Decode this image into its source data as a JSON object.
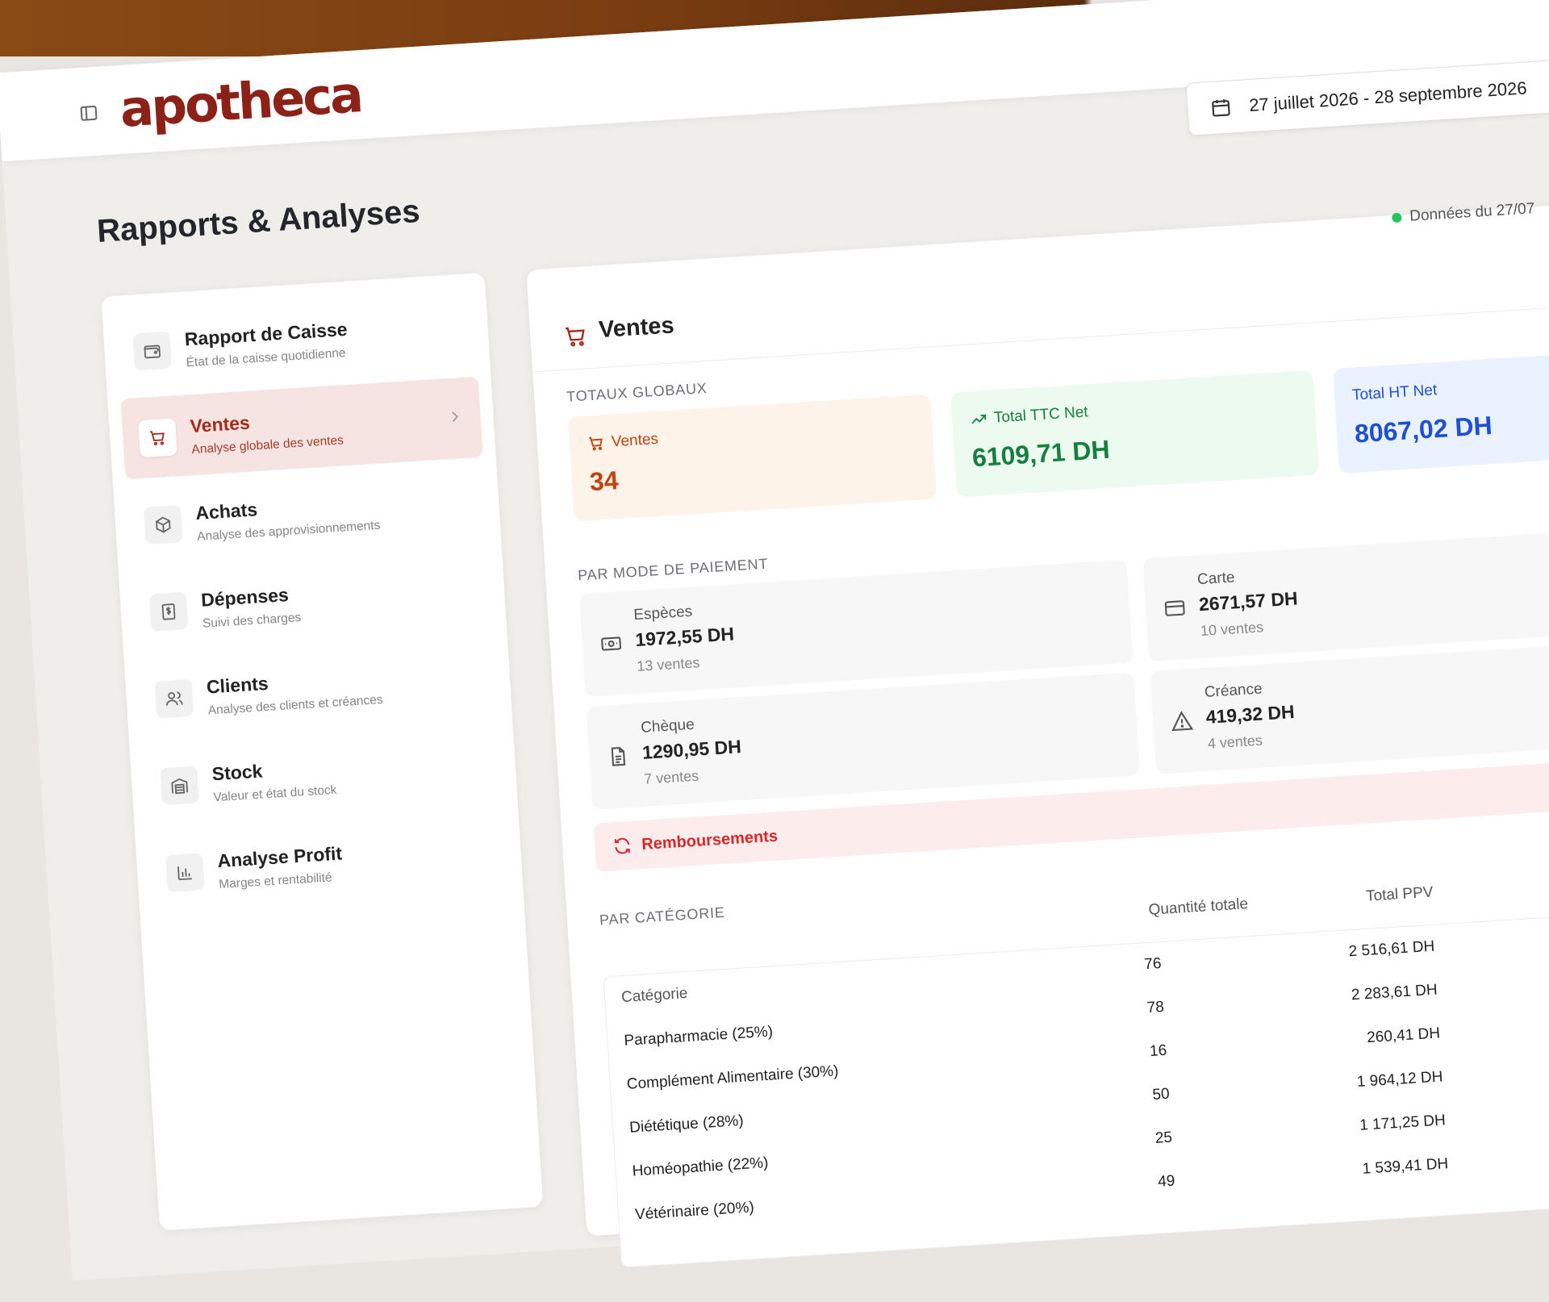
{
  "app": {
    "logo_text": "apotheca"
  },
  "header": {
    "date_range": "27 juillet 2026 - 28 septembre 2026"
  },
  "page": {
    "title": "Rapports & Analyses"
  },
  "nav": {
    "items": [
      {
        "title": "Rapport de Caisse",
        "subtitle": "État de la caisse quotidienne",
        "icon": "wallet-icon"
      },
      {
        "title": "Ventes",
        "subtitle": "Analyse globale des ventes",
        "icon": "cart-icon"
      },
      {
        "title": "Achats",
        "subtitle": "Analyse des approvisionnements",
        "icon": "box-icon"
      },
      {
        "title": "Dépenses",
        "subtitle": "Suivi des charges",
        "icon": "receipt-dollar-icon"
      },
      {
        "title": "Clients",
        "subtitle": "Analyse des clients et créances",
        "icon": "users-icon"
      },
      {
        "title": "Stock",
        "subtitle": "Valeur et état du stock",
        "icon": "warehouse-icon"
      },
      {
        "title": "Analyse Profit",
        "subtitle": "Marges et rentabilité",
        "icon": "bar-chart-icon"
      }
    ]
  },
  "main": {
    "status_text": "Données du 27/07",
    "section_title": "Ventes",
    "totals_label": "TOTAUX GLOBAUX",
    "totals": {
      "ventes_label": "Ventes",
      "ventes_value": "34",
      "ttc_label": "Total TTC Net",
      "ttc_value": "6109,71 DH",
      "ht_label": "Total HT Net",
      "ht_value": "8067,02 DH"
    },
    "payment_label": "PAR MODE DE PAIEMENT",
    "payments": [
      {
        "label": "Espèces",
        "value": "1972,55 DH",
        "count": "13 ventes"
      },
      {
        "label": "Carte",
        "value": "2671,57 DH",
        "count": "10 ventes"
      },
      {
        "label": "Chèque",
        "value": "1290,95 DH",
        "count": "7 ventes"
      },
      {
        "label": "Créance",
        "value": "419,32 DH",
        "count": "4 ventes"
      }
    ],
    "refunds_label": "Remboursements",
    "category_label": "PAR CATÉGORIE",
    "table": {
      "headers": {
        "category": "Catégorie",
        "quantity": "Quantité totale",
        "total": "Total PPV"
      },
      "rows": [
        {
          "category": "Parapharmacie (25%)",
          "quantity": "76",
          "total": "2 516,61 DH"
        },
        {
          "category": "Complément Alimentaire (30%)",
          "quantity": "78",
          "total": "2 283,61 DH"
        },
        {
          "category": "Diététique (28%)",
          "quantity": "16",
          "total": "260,41 DH"
        },
        {
          "category": "Homéopathie (22%)",
          "quantity": "50",
          "total": "1 964,12 DH"
        },
        {
          "category": "Vétérinaire (20%)",
          "quantity": "25",
          "total": "1 171,25 DH"
        },
        {
          "category": "",
          "quantity": "49",
          "total": "1 539,41 DH"
        }
      ]
    }
  },
  "colors": {
    "brand": "#8b2117",
    "orange": "#c2410c",
    "green": "#15803d",
    "blue": "#1d4ed8",
    "red": "#dc2626"
  }
}
